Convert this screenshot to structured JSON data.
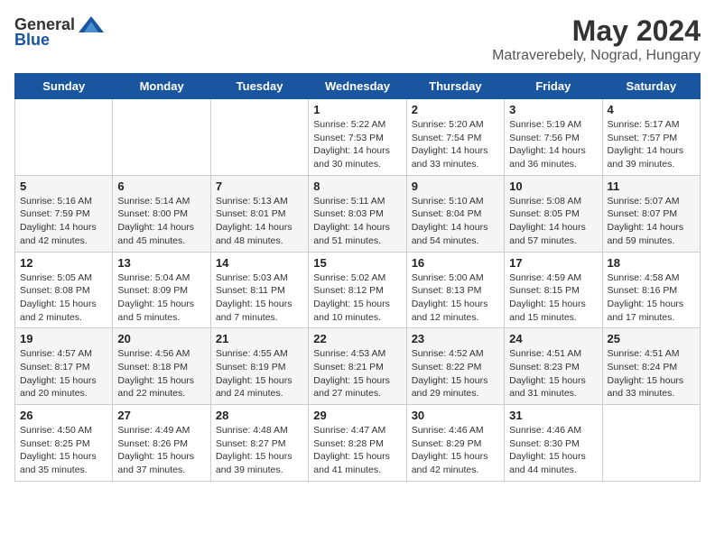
{
  "header": {
    "logo_general": "General",
    "logo_blue": "Blue",
    "month_title": "May 2024",
    "location": "Matraverebely, Nograd, Hungary"
  },
  "weekdays": [
    "Sunday",
    "Monday",
    "Tuesday",
    "Wednesday",
    "Thursday",
    "Friday",
    "Saturday"
  ],
  "weeks": [
    [
      {
        "day": "",
        "info": ""
      },
      {
        "day": "",
        "info": ""
      },
      {
        "day": "",
        "info": ""
      },
      {
        "day": "1",
        "info": "Sunrise: 5:22 AM\nSunset: 7:53 PM\nDaylight: 14 hours\nand 30 minutes."
      },
      {
        "day": "2",
        "info": "Sunrise: 5:20 AM\nSunset: 7:54 PM\nDaylight: 14 hours\nand 33 minutes."
      },
      {
        "day": "3",
        "info": "Sunrise: 5:19 AM\nSunset: 7:56 PM\nDaylight: 14 hours\nand 36 minutes."
      },
      {
        "day": "4",
        "info": "Sunrise: 5:17 AM\nSunset: 7:57 PM\nDaylight: 14 hours\nand 39 minutes."
      }
    ],
    [
      {
        "day": "5",
        "info": "Sunrise: 5:16 AM\nSunset: 7:59 PM\nDaylight: 14 hours\nand 42 minutes."
      },
      {
        "day": "6",
        "info": "Sunrise: 5:14 AM\nSunset: 8:00 PM\nDaylight: 14 hours\nand 45 minutes."
      },
      {
        "day": "7",
        "info": "Sunrise: 5:13 AM\nSunset: 8:01 PM\nDaylight: 14 hours\nand 48 minutes."
      },
      {
        "day": "8",
        "info": "Sunrise: 5:11 AM\nSunset: 8:03 PM\nDaylight: 14 hours\nand 51 minutes."
      },
      {
        "day": "9",
        "info": "Sunrise: 5:10 AM\nSunset: 8:04 PM\nDaylight: 14 hours\nand 54 minutes."
      },
      {
        "day": "10",
        "info": "Sunrise: 5:08 AM\nSunset: 8:05 PM\nDaylight: 14 hours\nand 57 minutes."
      },
      {
        "day": "11",
        "info": "Sunrise: 5:07 AM\nSunset: 8:07 PM\nDaylight: 14 hours\nand 59 minutes."
      }
    ],
    [
      {
        "day": "12",
        "info": "Sunrise: 5:05 AM\nSunset: 8:08 PM\nDaylight: 15 hours\nand 2 minutes."
      },
      {
        "day": "13",
        "info": "Sunrise: 5:04 AM\nSunset: 8:09 PM\nDaylight: 15 hours\nand 5 minutes."
      },
      {
        "day": "14",
        "info": "Sunrise: 5:03 AM\nSunset: 8:11 PM\nDaylight: 15 hours\nand 7 minutes."
      },
      {
        "day": "15",
        "info": "Sunrise: 5:02 AM\nSunset: 8:12 PM\nDaylight: 15 hours\nand 10 minutes."
      },
      {
        "day": "16",
        "info": "Sunrise: 5:00 AM\nSunset: 8:13 PM\nDaylight: 15 hours\nand 12 minutes."
      },
      {
        "day": "17",
        "info": "Sunrise: 4:59 AM\nSunset: 8:15 PM\nDaylight: 15 hours\nand 15 minutes."
      },
      {
        "day": "18",
        "info": "Sunrise: 4:58 AM\nSunset: 8:16 PM\nDaylight: 15 hours\nand 17 minutes."
      }
    ],
    [
      {
        "day": "19",
        "info": "Sunrise: 4:57 AM\nSunset: 8:17 PM\nDaylight: 15 hours\nand 20 minutes."
      },
      {
        "day": "20",
        "info": "Sunrise: 4:56 AM\nSunset: 8:18 PM\nDaylight: 15 hours\nand 22 minutes."
      },
      {
        "day": "21",
        "info": "Sunrise: 4:55 AM\nSunset: 8:19 PM\nDaylight: 15 hours\nand 24 minutes."
      },
      {
        "day": "22",
        "info": "Sunrise: 4:53 AM\nSunset: 8:21 PM\nDaylight: 15 hours\nand 27 minutes."
      },
      {
        "day": "23",
        "info": "Sunrise: 4:52 AM\nSunset: 8:22 PM\nDaylight: 15 hours\nand 29 minutes."
      },
      {
        "day": "24",
        "info": "Sunrise: 4:51 AM\nSunset: 8:23 PM\nDaylight: 15 hours\nand 31 minutes."
      },
      {
        "day": "25",
        "info": "Sunrise: 4:51 AM\nSunset: 8:24 PM\nDaylight: 15 hours\nand 33 minutes."
      }
    ],
    [
      {
        "day": "26",
        "info": "Sunrise: 4:50 AM\nSunset: 8:25 PM\nDaylight: 15 hours\nand 35 minutes."
      },
      {
        "day": "27",
        "info": "Sunrise: 4:49 AM\nSunset: 8:26 PM\nDaylight: 15 hours\nand 37 minutes."
      },
      {
        "day": "28",
        "info": "Sunrise: 4:48 AM\nSunset: 8:27 PM\nDaylight: 15 hours\nand 39 minutes."
      },
      {
        "day": "29",
        "info": "Sunrise: 4:47 AM\nSunset: 8:28 PM\nDaylight: 15 hours\nand 41 minutes."
      },
      {
        "day": "30",
        "info": "Sunrise: 4:46 AM\nSunset: 8:29 PM\nDaylight: 15 hours\nand 42 minutes."
      },
      {
        "day": "31",
        "info": "Sunrise: 4:46 AM\nSunset: 8:30 PM\nDaylight: 15 hours\nand 44 minutes."
      },
      {
        "day": "",
        "info": ""
      }
    ]
  ]
}
